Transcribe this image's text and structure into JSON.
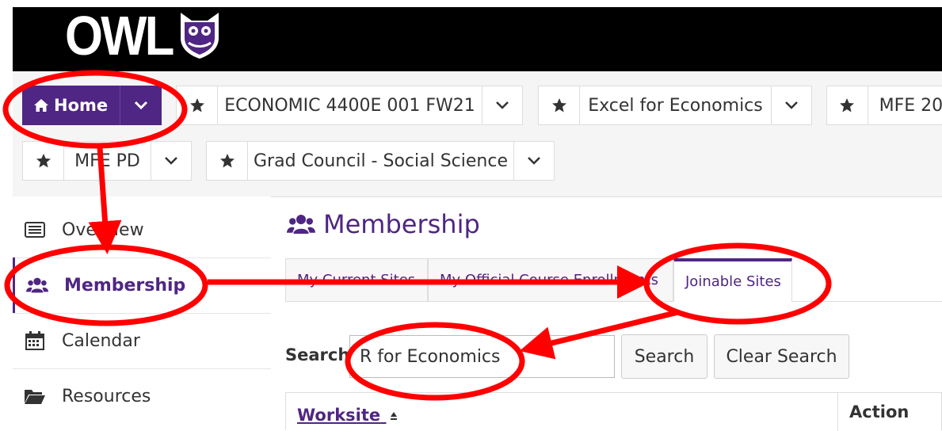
{
  "header": {
    "logo_text": "OWL"
  },
  "nav": {
    "home_label": "Home",
    "sites": [
      "ECONOMIC 4400E 001 FW21",
      "Excel for Economics",
      "MFE 20",
      "MFE PD",
      "Grad Council - Social Science"
    ]
  },
  "sidebar": {
    "items": [
      {
        "label": "Overview",
        "icon": "overview-icon"
      },
      {
        "label": "Membership",
        "icon": "users-icon"
      },
      {
        "label": "Calendar",
        "icon": "calendar-icon"
      },
      {
        "label": "Resources",
        "icon": "folder-icon"
      }
    ]
  },
  "main": {
    "title": "Membership",
    "tabs": [
      "My Current Sites",
      "My Official Course Enrollments",
      "Joinable Sites"
    ],
    "active_tab": "Joinable Sites",
    "search_label": "Search",
    "search_value": "R for Economics",
    "search_button": "Search",
    "clear_button": "Clear Search",
    "table_headers": {
      "worksite": "Worksite",
      "action": "Action"
    }
  },
  "colors": {
    "brand": "#4f2683",
    "header": "#000000",
    "annotation": "#ff0000"
  }
}
